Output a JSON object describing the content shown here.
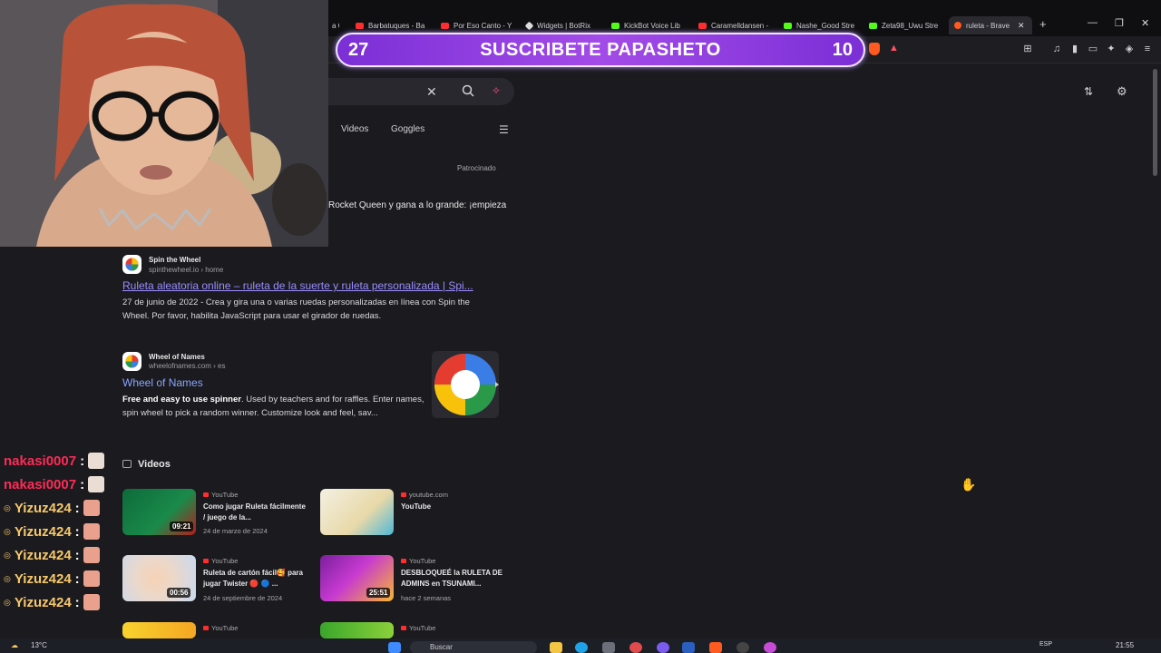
{
  "browser": {
    "tabs": [
      {
        "label": "Barbatuques - Ba",
        "color": "#ff2d2d"
      },
      {
        "label": "Por Eso Canto - Y",
        "color": "#ff2d2d"
      },
      {
        "label": "Widgets | BotRix",
        "color": "#bbbbbb"
      },
      {
        "label": "KickBot Voice Lib",
        "color": "#53fc18"
      },
      {
        "label": "Caramelldansen -",
        "color": "#ff2d2d"
      },
      {
        "label": "Nashe_Good Stre",
        "color": "#53fc18"
      },
      {
        "label": "Zeta98_Uwu Stre",
        "color": "#53fc18"
      },
      {
        "label": "ruleta - Brave",
        "color": "#ff5a1f"
      }
    ],
    "partial_tab": "a C"
  },
  "overlay": {
    "left_count": "27",
    "title": "SUSCRIBETE PAPASHETO",
    "right_count": "10"
  },
  "search": {
    "tabs": [
      "Videos",
      "Goggles"
    ],
    "sponsored_label": "Patrocinado",
    "ad_text": "Rocket Queen y gana a lo grande: ¡empieza"
  },
  "results": [
    {
      "site": "Spin the Wheel",
      "url": "spinthewheel.io › home",
      "title": "Ruleta aleatoria online – ruleta de la suerte y ruleta personalizada | Spi...",
      "snippet_date": "27 de junio de 2022",
      "snippet": " - Crea y gira una o varias ruedas personalizadas en línea con Spin the Wheel. Por favor, habilita JavaScript para usar el girador de ruedas."
    },
    {
      "site": "Wheel of Names",
      "url": "wheelofnames.com › es",
      "title": "Wheel of Names",
      "snippet_bold": "Free and easy to use spinner",
      "snippet": ". Used by teachers and for raffles. Enter names, spin wheel to pick a random winner. Customize look and feel, sav..."
    }
  ],
  "videos_header": "Videos",
  "videos": [
    {
      "source": "YouTube",
      "title": "Como jugar Ruleta fácilmente / juego de la...",
      "date": "24 de marzo de 2024",
      "duration": "09:21"
    },
    {
      "source": "youtube.com",
      "title": "YouTube",
      "date": "",
      "duration": ""
    },
    {
      "source": "YouTube",
      "title": "Ruleta de cartón fácil🥰 para jugar Twister 🔴 🔵 ...",
      "date": "24 de septiembre de 2024",
      "duration": "00:56"
    },
    {
      "source": "YouTube",
      "title": "DESBLOQUEÉ la RULETA DE ADMINS en TSUNAMI...",
      "date": "hace 2 semanas",
      "duration": "25:51"
    },
    {
      "source": "YouTube",
      "title": "",
      "date": "",
      "duration": ""
    },
    {
      "source": "YouTube",
      "title": "",
      "date": "",
      "duration": ""
    }
  ],
  "chat": [
    {
      "user": "nakasi0007",
      "sep": ":",
      "color": "pink"
    },
    {
      "user": "nakasi0007",
      "sep": ":",
      "color": "pink"
    },
    {
      "user": "Yizuz424",
      "sep": ":",
      "color": "gold"
    },
    {
      "user": "Yizuz424",
      "sep": ":",
      "color": "gold"
    },
    {
      "user": "Yizuz424",
      "sep": ":",
      "color": "gold"
    },
    {
      "user": "Yizuz424",
      "sep": ":",
      "color": "gold"
    },
    {
      "user": "Yizuz424",
      "sep": ":",
      "color": "gold"
    }
  ],
  "taskbar": {
    "temperature": "13°C",
    "search_placeholder": "Buscar",
    "language": "ESP",
    "time": "21:55"
  }
}
